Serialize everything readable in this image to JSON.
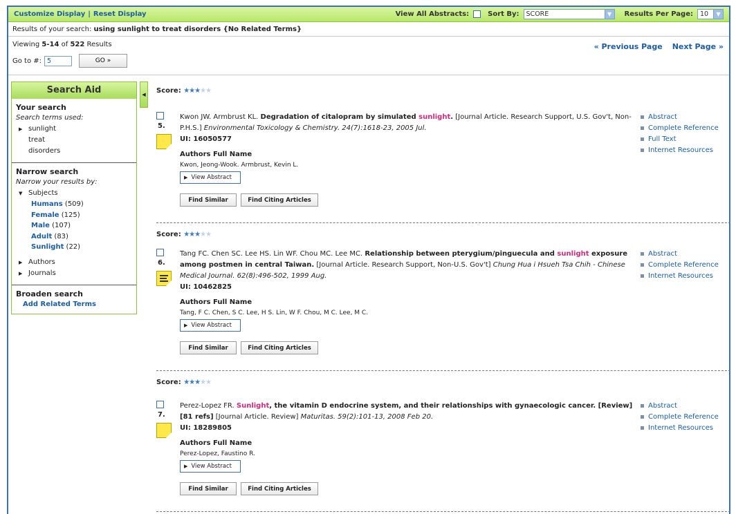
{
  "topbar": {
    "customize": "Customize Display",
    "separator": "|",
    "reset": "Reset Display",
    "view_all_label": "View All Abstracts:",
    "sort_label": "Sort By:",
    "sort_value": "SCORE",
    "per_page_label": "Results Per Page:",
    "per_page_value": "10"
  },
  "search_summary": {
    "prefix": "Results of your search:",
    "query": "using sunlight to treat disorders {No Related Terms}"
  },
  "pager": {
    "viewing_prefix": "Viewing",
    "range": "5-14",
    "of_word": "of",
    "total": "522",
    "results_word": "Results",
    "goto_label": "Go to #:",
    "goto_value": "5",
    "go_button": "GO »",
    "prev": "« Previous Page",
    "next": "Next Page »"
  },
  "sidebar": {
    "title": "Search Aid",
    "your_search": "Your search",
    "terms_used": "Search terms used:",
    "terms": [
      "sunlight",
      "treat",
      "disorders"
    ],
    "narrow": "Narrow search",
    "narrow_sub": "Narrow your results by:",
    "subjects": "Subjects",
    "subject_items": [
      {
        "name": "Humans",
        "count": "(509)"
      },
      {
        "name": "Female",
        "count": "(125)"
      },
      {
        "name": "Male",
        "count": "(107)"
      },
      {
        "name": "Adult",
        "count": "(83)"
      },
      {
        "name": "Sunlight",
        "count": "(22)"
      }
    ],
    "authors": "Authors",
    "journals": "Journals",
    "broaden": "Broaden search",
    "add_related": "Add Related Terms"
  },
  "results": [
    {
      "score_label": "Score:",
      "stars_on": 3,
      "stars_off": 2,
      "number": "5.",
      "ui": "UI: 16050577",
      "authors_heading": "Authors Full Name",
      "authors_full": "Kwon, Jeong-Wook. Armbrust, Kevin L.",
      "links": [
        "Abstract",
        "Complete Reference",
        "Full Text",
        "Internet Resources"
      ]
    },
    {
      "score_label": "Score:",
      "stars_on": 3,
      "stars_off": 2,
      "number": "6.",
      "ui": "UI: 10462825",
      "authors_heading": "Authors Full Name",
      "authors_full": "Tang, F C. Chen, S C. Lee, H S. Lin, W F. Chou, M C. Lee, M C.",
      "links": [
        "Abstract",
        "Complete Reference",
        "Internet Resources"
      ]
    },
    {
      "score_label": "Score:",
      "stars_on": 3,
      "stars_off": 2,
      "number": "7.",
      "ui": "UI: 18289805",
      "authors_heading": "Authors Full Name",
      "authors_full": "Perez-Lopez, Faustino R.",
      "links": [
        "Abstract",
        "Complete Reference",
        "Internet Resources"
      ]
    }
  ],
  "citations": {
    "r0": {
      "authors": "Kwon JW. Armbrust KL.",
      "title_a": "Degradation of citalopram by simulated",
      "hl": "sunlight",
      "title_b": ".",
      "pubtype": "[Journal Article. Research Support, U.S. Gov't, Non-P.H.S.]",
      "source": "Environmental Toxicology & Chemistry. 24(7):1618-23, 2005 Jul."
    },
    "r1": {
      "authors": "Tang FC. Chen SC. Lee HS. Lin WF. Chou MC. Lee MC.",
      "title_a": "Relationship between pterygium/pinguecula and",
      "hl": "sunlight",
      "title_b": "exposure among postmen in central Taiwan.",
      "pubtype": "[Journal Article. Research Support, Non-U.S. Gov't]",
      "source": "Chung Hua i Hsueh Tsa Chih - Chinese Medical Journal. 62(8):496-502, 1999 Aug."
    },
    "r2": {
      "authors": "Perez-Lopez FR.",
      "hl": "Sunlight",
      "title_b": ", the vitamin D endocrine system, and their relationships with gynaecologic cancer. [Review] [81 refs]",
      "pubtype": "[Journal Article. Review]",
      "source": "Maturitas. 59(2):101-13, 2008 Feb 20."
    }
  },
  "buttons": {
    "view_abstract": "View Abstract",
    "find_similar": "Find Similar",
    "find_citing": "Find Citing Articles"
  }
}
